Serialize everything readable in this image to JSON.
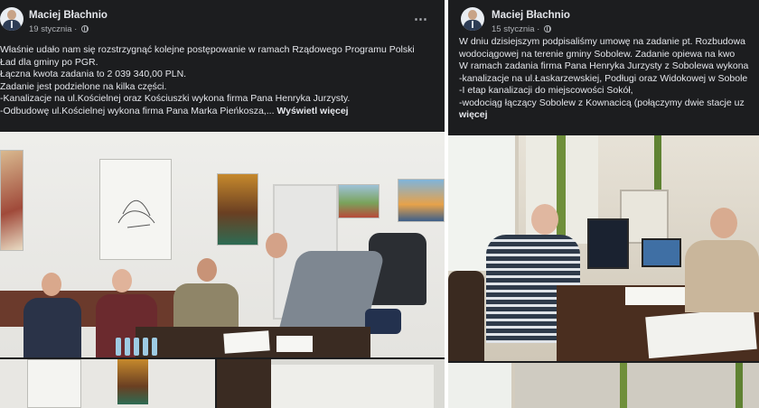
{
  "left_post": {
    "author": "Maciej Błachnio",
    "date": "19 stycznia",
    "more_icon": "⋯",
    "lines": [
      "Właśnie udało nam się rozstrzygnąć kolejne postępowanie w ramach Rządowego Programu Polski",
      "Ład dla gminy po PGR.",
      "Łączna kwota zadania to 2 039 340,00 PLN.",
      "Zadanie jest podzielone na kilka części.",
      "-Kanalizacje na ul.Kościelnej oraz Kościuszki  wykona firma Pana Henryka Jurzysty.",
      "-Odbudowę ul.Kościelnej wykona firma Pana Marka Pieńkosza,..."
    ],
    "see_more": "Wyświetl więcej"
  },
  "right_post": {
    "author": "Maciej Błachnio",
    "date": "15 stycznia",
    "lines": [
      "W dniu dzisiejszym podpisaliśmy umowę na zadanie pt. Rozbudowa",
      "wodociągowej na terenie gminy Sobolew. Zadanie opiewa na kwo",
      "W ramach zadania firma Pana Henryka Jurzysty z Sobolewa wykona",
      "-kanalizacje na ul.Łaskarzewskiej, Podługi oraz Widokowej w Sobole",
      "-I etap kanalizacji do miejscowości Sokół,",
      "-wodociąg łączący Sobolew z Kownacicą (połączymy dwie stacje uz"
    ],
    "see_more": "więcej"
  },
  "colors": {
    "post_bg": "#1c1d1f",
    "text": "#e4e6eb",
    "muted": "#b0b3b8"
  }
}
